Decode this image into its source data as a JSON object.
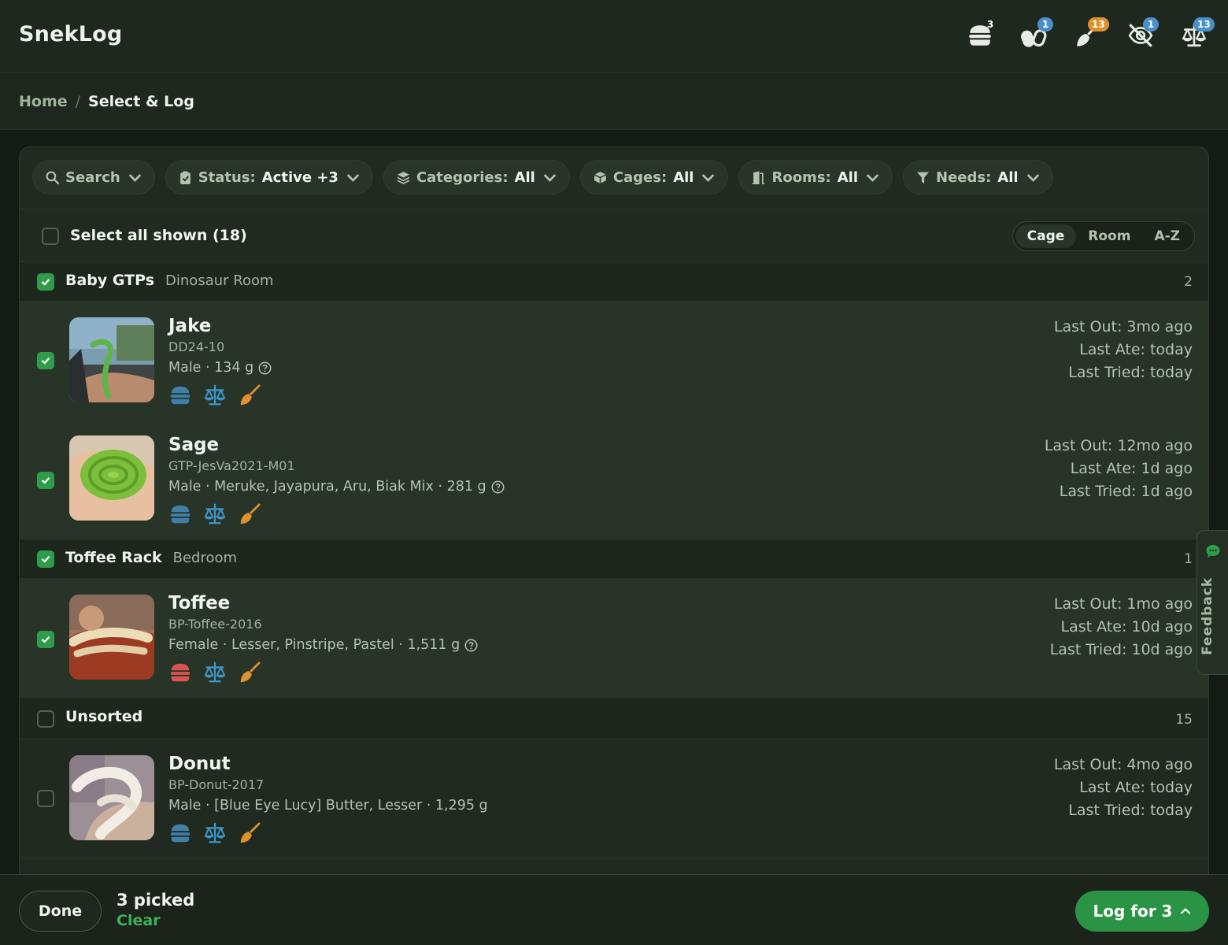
{
  "app": {
    "title": "SnekLog"
  },
  "header_icons": [
    {
      "name": "burger-icon",
      "badge": "3",
      "badge_color": "#d9534f"
    },
    {
      "name": "pill-icon",
      "badge": "1",
      "badge_color": "#4a90c8"
    },
    {
      "name": "broom-icon",
      "badge": "13",
      "badge_color": "#e0912e"
    },
    {
      "name": "eye-slash-icon",
      "badge": "1",
      "badge_color": "#4a90c8"
    },
    {
      "name": "scale-icon",
      "badge": "13",
      "badge_color": "#4a90c8"
    }
  ],
  "breadcrumb": {
    "home": "Home",
    "separator": "/",
    "current": "Select & Log"
  },
  "filters": {
    "search": {
      "label": "Search"
    },
    "status": {
      "label": "Status:",
      "value": "Active +3"
    },
    "categories": {
      "label": "Categories:",
      "value": "All"
    },
    "cages": {
      "label": "Cages:",
      "value": "All"
    },
    "rooms": {
      "label": "Rooms:",
      "value": "All"
    },
    "needs": {
      "label": "Needs:",
      "value": "All"
    }
  },
  "select_all": {
    "label": "Select all shown (18)",
    "checked": false
  },
  "sort": {
    "options": [
      "Cage",
      "Room",
      "A-Z"
    ],
    "selected": "Cage"
  },
  "groups": [
    {
      "name": "Baby GTPs",
      "room": "Dinosaur Room",
      "count": "2",
      "checked": true
    },
    {
      "name": "Toffee Rack",
      "room": "Bedroom",
      "count": "1",
      "checked": true
    },
    {
      "name": "Unsorted",
      "room": "",
      "count": "15",
      "checked": false
    }
  ],
  "animals": [
    {
      "name": "Jake",
      "id": "DD24-10",
      "desc": "Male · 134 g",
      "checked": true,
      "last_out": "Last Out: 3mo ago",
      "last_ate": "Last Ate: today",
      "last_tried": "Last Tried: today",
      "feed_icon_color": "#3f7fa8"
    },
    {
      "name": "Sage",
      "id": "GTP-JesVa2021-M01",
      "desc": "Male · Meruke, Jayapura, Aru, Biak Mix · 281 g",
      "checked": true,
      "last_out": "Last Out: 12mo ago",
      "last_ate": "Last Ate: 1d ago",
      "last_tried": "Last Tried: 1d ago",
      "feed_icon_color": "#3f7fa8"
    },
    {
      "name": "Toffee",
      "id": "BP-Toffee-2016",
      "desc": "Female · Lesser, Pinstripe, Pastel · 1,511 g",
      "checked": true,
      "last_out": "Last Out: 1mo ago",
      "last_ate": "Last Ate: 10d ago",
      "last_tried": "Last Tried: 10d ago",
      "feed_icon_color": "#d9534f"
    },
    {
      "name": "Donut",
      "id": "BP-Donut-2017",
      "desc": "Male · [Blue Eye Lucy] Butter, Lesser · 1,295 g",
      "checked": false,
      "last_out": "Last Out: 4mo ago",
      "last_ate": "Last Ate: today",
      "last_tried": "Last Tried: today",
      "feed_icon_color": "#3f7fa8"
    }
  ],
  "feedback": {
    "label": "Feedback"
  },
  "bottom": {
    "done": "Done",
    "picked": "3 picked",
    "clear": "Clear",
    "log": "Log for 3"
  },
  "colors": {
    "accent": "#2a9444",
    "scale_icon": "#3f94c8",
    "broom_icon": "#e0912e"
  }
}
